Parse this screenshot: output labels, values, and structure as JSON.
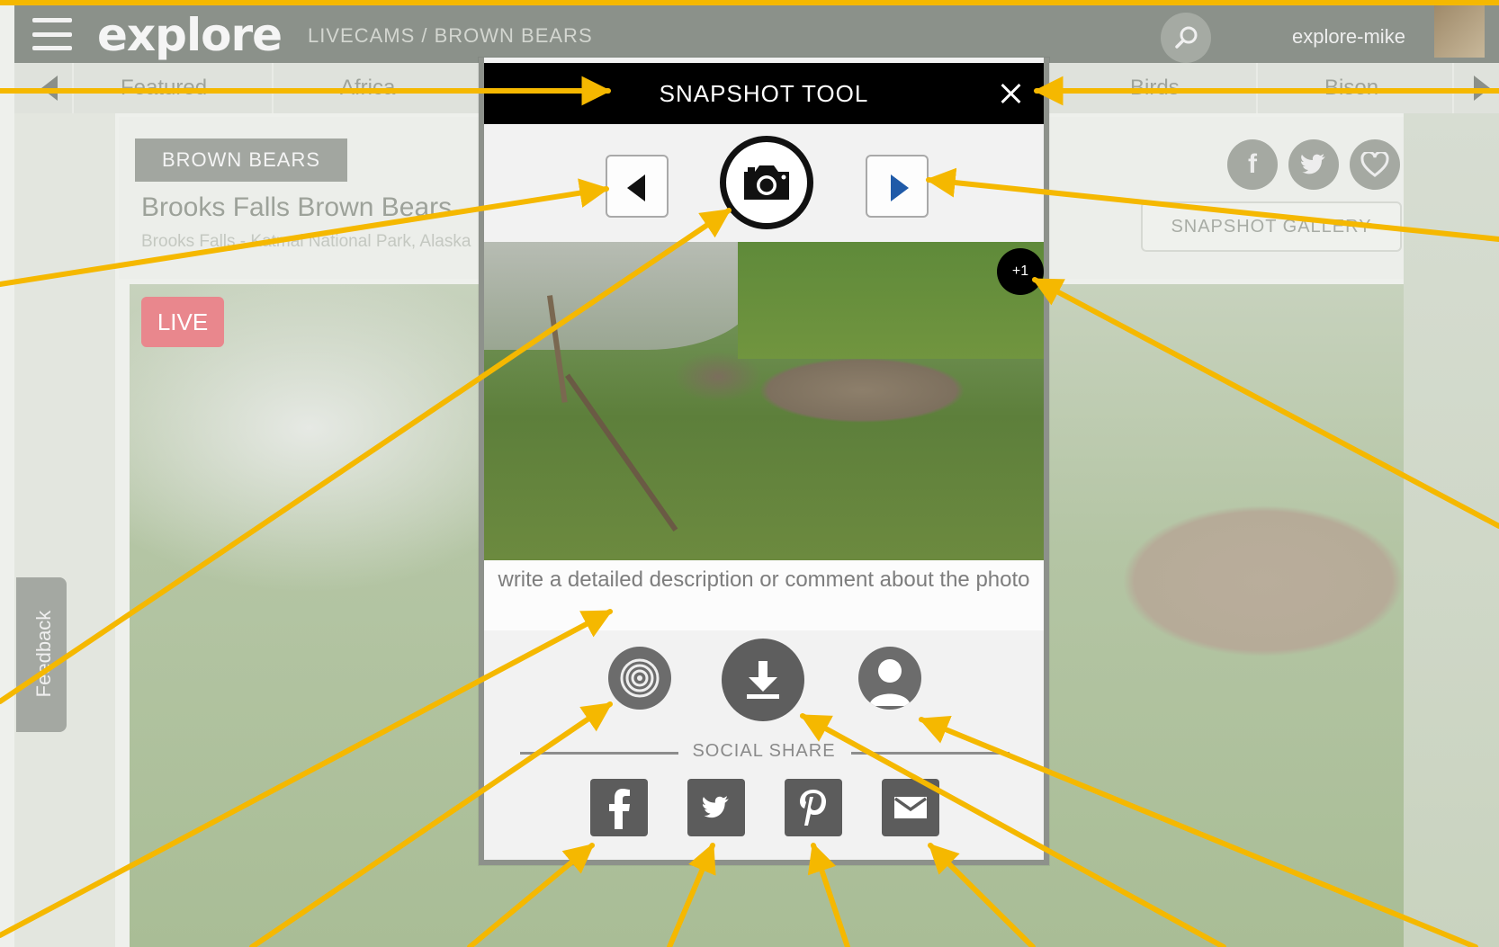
{
  "app": {
    "logo": "explore",
    "breadcrumb": "LIVECAMS / BROWN BEARS",
    "username": "explore-mike",
    "icons": {
      "menu": "hamburger-icon",
      "search": "search-icon",
      "avatar": "user-avatar"
    }
  },
  "categories": {
    "items": [
      "Featured",
      "Africa",
      "Birds",
      "Bison"
    ]
  },
  "feedback": {
    "label": "Feedback"
  },
  "cam": {
    "badge": "BROWN BEARS",
    "title": "Brooks Falls Brown Bears",
    "subtitle": "Brooks Falls - Katmai National Park, Alaska",
    "live_label": "LIVE",
    "snapshot_gallery_label": "SNAPSHOT GALLERY",
    "share_icons": [
      "facebook-icon",
      "twitter-icon",
      "heart-icon"
    ]
  },
  "modal": {
    "title": "SNAPSHOT TOOL",
    "close_icon": "close-icon",
    "prev_icon": "arrow-left-icon",
    "next_icon": "arrow-right-icon",
    "capture_icon": "camera-icon",
    "plus_one_label": "+1",
    "description_placeholder": "write a detailed description or comment about the photo",
    "actions": {
      "community_icon": "explore-community-icon",
      "download_icon": "download-icon",
      "profile_icon": "profile-icon"
    },
    "social_share_label": "SOCIAL SHARE",
    "social": {
      "facebook_icon": "facebook-icon",
      "twitter_icon": "twitter-icon",
      "pinterest_icon": "pinterest-icon",
      "email_icon": "mail-icon"
    }
  },
  "colors": {
    "accent_arrow": "#f5b800",
    "modal_header": "#000000",
    "next_arrow": "#1f5aa8",
    "live_badge": "#e9878d"
  }
}
